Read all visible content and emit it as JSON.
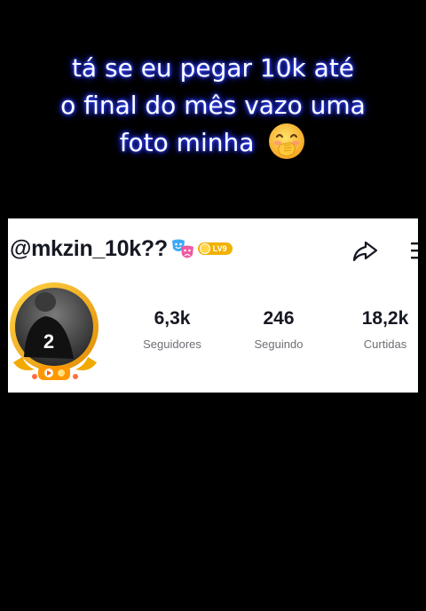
{
  "caption": {
    "line1": "tá se eu pegar 10k até",
    "line2": "o final do mês vazo uma",
    "line3": "foto minha",
    "emoji": "face-with-hand-over-mouth-emoji"
  },
  "profile": {
    "username": "@mkzin_10k??",
    "badge_icon": "theater-masks-icon",
    "level_badge": "LV9",
    "share_icon": "share-arrow-icon",
    "menu_icon": "menu-icon",
    "avatar_jersey_number": "2",
    "stats": [
      {
        "value": "6,3k",
        "label": "Seguidores"
      },
      {
        "value": "246",
        "label": "Seguindo"
      },
      {
        "value": "18,2k",
        "label": "Curtidas"
      }
    ]
  },
  "colors": {
    "background": "#000000",
    "caption_text": "#ffffff",
    "caption_glow": "#2b3cff",
    "card_background": "#ffffff",
    "primary_text": "#161823",
    "secondary_text": "#6e6f75",
    "avatar_ring": "#f5b400"
  }
}
